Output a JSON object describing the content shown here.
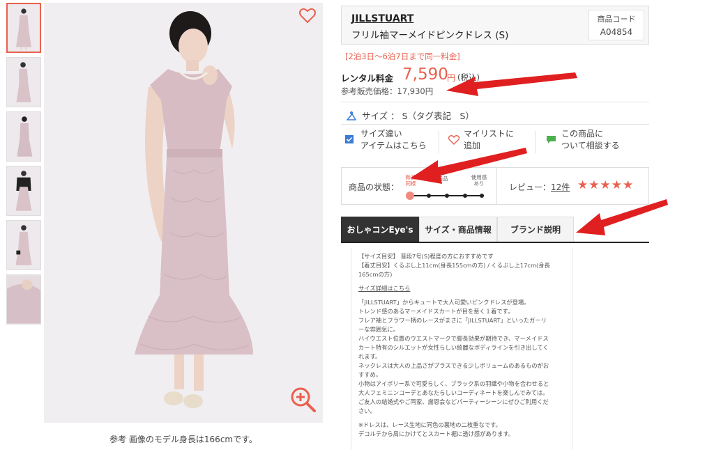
{
  "gallery": {
    "thumbnail_count": 6,
    "active_index": 0,
    "caption": "参考 画像のモデル身長は166cmです。"
  },
  "product": {
    "brand": "JILLSTUART",
    "name": "フリル袖マーメイドピンクドレス (S)",
    "code_label": "商品コード",
    "code_value": "A04854",
    "period_note": "[2泊3日〜6泊7日まで同一料金]",
    "rental_label": "レンタル料金",
    "rental_price": "7,590",
    "rental_yen": "円",
    "tax_note": "(税込)",
    "reference_price": "参考販売価格：17,930円",
    "size_text": "サイズ ： S（タグ表記　S）"
  },
  "actions": {
    "size_match_line1": "サイズ違い",
    "size_match_line2": "アイテムはこちら",
    "mylist_line1": "マイリストに",
    "mylist_line2": "追加",
    "consult_line1": "この商品に",
    "consult_line2": "ついて相談する"
  },
  "condition": {
    "label": "商品の状態：",
    "scale_labels": [
      "新品\n同様",
      "",
      "美品",
      "",
      "使用感\nあり"
    ],
    "active_level": 0,
    "review_label": "レビュー：",
    "review_count": "12件",
    "rating": 5
  },
  "tabs": [
    "おしゃコンEye's",
    "サイズ・商品情報",
    "ブランド説明"
  ],
  "active_tab": 0,
  "description": {
    "size_line1": "【サイズ目安】 普段7号(S)程度の方におすすめです",
    "size_line2": "【着丈目安】くるぶし上11cm(身長155cmの方) / くるぶし上17cm(身長",
    "size_line3": "165cmの方)",
    "size_link": "サイズ詳細はこちら",
    "para1": "「JILLSTUART」からキュートで大人可愛いピンクドレスが登場。",
    "para2": "トレンド感のあるマーメイドスカートが目を惹く１着です。",
    "para3": "フレア袖とフラワー柄のレースがまさに「JILLSTUART」といったガーリ",
    "para4": "ーな雰囲気に。",
    "para5": "ハイウエスト位置のウエストマークで脚長効果が期待でき、マーメイドス",
    "para6": "カート特有のシルエットが女性らしい綺麗なボディラインを引き出してく",
    "para7": "れます。",
    "para8": "ネックレスは大人の上品さがプラスできる少しボリュームのあるものがお",
    "para9": "すすめ。",
    "para10": "小物はアイボリー系で可愛らしく、ブラック系の羽織や小物を合わせると",
    "para11": "大人フェミニンコーデとあなたらしいコーディネートを楽しんでみては。",
    "para12": "ご友人の結婚式やご両家、謝恩会などパーティーシーンにぜひご利用くだ",
    "para13": "さい。",
    "note1": "※ドレスは、レース生地に同色の裏地の二枚重なです。",
    "note2": "デコルテから肩にかけてとスカート裾に透け感があります。"
  },
  "colors": {
    "accent": "#e9604f",
    "annotation_arrow": "#e02020",
    "active_tab_bg": "#333333",
    "star": "#e9604f"
  }
}
